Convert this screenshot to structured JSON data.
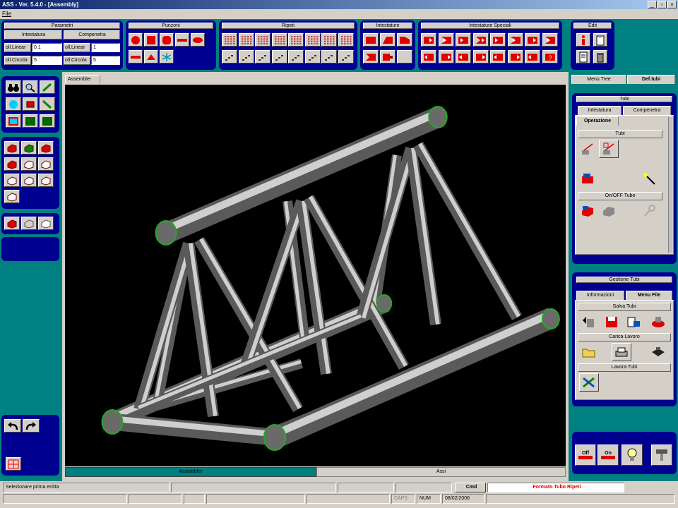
{
  "window": {
    "title": "ASS - Ver. 5.4.0 - [Assembly]",
    "minimize": "_",
    "restore": "▫",
    "close": "×"
  },
  "menu": {
    "file": "File"
  },
  "parametri": {
    "title": "Parametri",
    "col1": "Intestatura",
    "col2": "Compenetra",
    "rows": [
      {
        "lbl1": "oll.Linear",
        "val1": "0.1",
        "lbl2": "oll.Linear",
        "val2": "1"
      },
      {
        "lbl1": "oll.Circola",
        "val1": "5",
        "lbl2": "oll.Circola",
        "val2": "5"
      }
    ]
  },
  "punzoni": {
    "title": "Punzoni"
  },
  "ripeti": {
    "title": "Ripeti"
  },
  "intestature": {
    "title": "Intestature"
  },
  "intestature_speciali": {
    "title": "Intestature Speciali"
  },
  "edit": {
    "title": "Edit"
  },
  "viewport": {
    "tab": "Assembler",
    "bottom_left": "Assembler",
    "bottom_right": "Assi"
  },
  "right": {
    "top_tabs": [
      "Menu Tree",
      "Def.tubi"
    ],
    "tubi": {
      "title": "Tubi",
      "tabs": [
        "Intestatura",
        "Compenetra"
      ],
      "subtab": "Operazione",
      "sec1": "Tubi",
      "sec2": "On/OFF Tubo"
    },
    "gestione": {
      "title": "Gestione Tubi",
      "tabs": [
        "Informazioni",
        "Menu File"
      ],
      "sec1": "Salva Tubi",
      "sec2": "Carica Lavoro",
      "sec3": "Lavora Tubi"
    },
    "bottom": {
      "off": "Off",
      "on": "On"
    }
  },
  "status": {
    "message": "Selezionare prima entita",
    "cmd": "Cmd",
    "format": "Formato Tubo Ripeti",
    "caps": "CAPS",
    "num": "NUM",
    "date": "08/02/2006"
  },
  "colors": {
    "teal": "#008080",
    "navy": "#000090",
    "tube_edge": "#22aa22"
  }
}
